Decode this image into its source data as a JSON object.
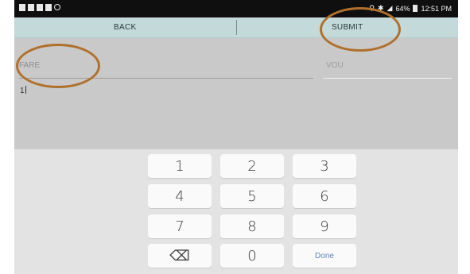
{
  "status_bar": {
    "left_icons": [
      "message-icon",
      "warning-icon",
      "media-icon",
      "mail-icon",
      "sync-icon"
    ],
    "right_icons": [
      "location-icon",
      "bluetooth-icon",
      "signal-icon"
    ],
    "battery_text": "64%",
    "time": "12:51 PM"
  },
  "action_bar": {
    "back_label": "BACK",
    "submit_label": "SUBMIT"
  },
  "form": {
    "fare_placeholder": "FARE",
    "vou_placeholder": "VOU",
    "note_value": "1"
  },
  "keypad": {
    "keys": [
      "1",
      "2",
      "3",
      "4",
      "5",
      "6",
      "7",
      "8",
      "9",
      "⌫",
      "0",
      "Done"
    ]
  },
  "colors": {
    "action_bar": "#c4d9d9",
    "form_background": "#c9c9c9",
    "keyboard_background": "#e3e3e3",
    "done_key_text": "#5b86c4",
    "highlight_ring": "#b0702b"
  }
}
